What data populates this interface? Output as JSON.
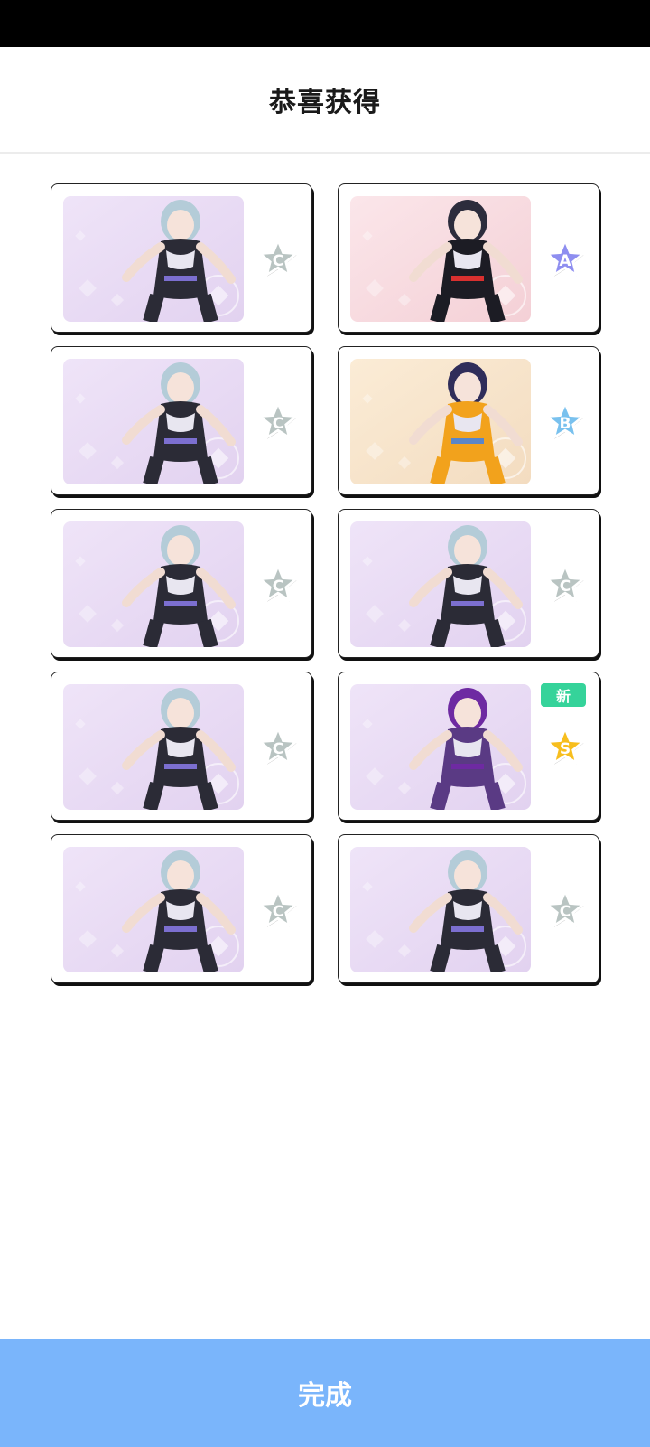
{
  "header": {
    "title": "恭喜获得"
  },
  "cards": [
    {
      "rank": "C",
      "new": false,
      "theme": "lilac"
    },
    {
      "rank": "A",
      "new": false,
      "theme": "pink"
    },
    {
      "rank": "C",
      "new": false,
      "theme": "lilac"
    },
    {
      "rank": "B",
      "new": false,
      "theme": "peach"
    },
    {
      "rank": "C",
      "new": false,
      "theme": "lilac"
    },
    {
      "rank": "C",
      "new": false,
      "theme": "lilac"
    },
    {
      "rank": "C",
      "new": false,
      "theme": "lilac"
    },
    {
      "rank": "S",
      "new": true,
      "new_label": "新",
      "theme": "lilac-purple"
    },
    {
      "rank": "C",
      "new": false,
      "theme": "lilac"
    },
    {
      "rank": "C",
      "new": false,
      "theme": "lilac"
    }
  ],
  "rank_colors": {
    "C": "#b9c4c2",
    "A": "#8e8ef0",
    "B": "#79c1ee",
    "S": "#f7be1e"
  },
  "footer": {
    "done_label": "完成"
  }
}
